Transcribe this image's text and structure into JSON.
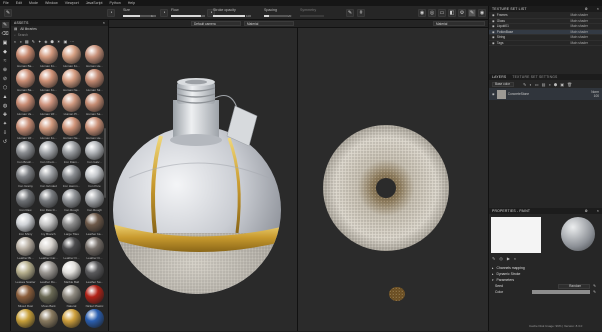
{
  "menu": [
    "File",
    "Edit",
    "Mode",
    "Window",
    "Viewport",
    "JavaScript",
    "Python",
    "Help"
  ],
  "toolbar": {
    "size_label": "Size",
    "size_value": "100",
    "size_pct": 0.55,
    "flow_label": "Flow",
    "flow_value": "100",
    "flow_pct": 1.0,
    "stroke_label": "Stroke opacity",
    "stroke_value": "100",
    "stroke_pct": 1.0,
    "spacing_label": "Spacing",
    "spacing_value": "20",
    "spacing_pct": 0.2,
    "symmetry_label": "Symmetry"
  },
  "assets": {
    "title": "ASSETS",
    "all_label": "All libraries",
    "search_placeholder": "Search",
    "items": [
      {
        "label": "Human Ba...",
        "color": "#c98a70"
      },
      {
        "label": "Human Fo...",
        "color": "#d49a7f"
      },
      {
        "label": "Human Fo...",
        "color": "#d6a083"
      },
      {
        "label": "Human He...",
        "color": "#c8917a"
      },
      {
        "label": "Human Ba...",
        "color": "#cd9077"
      },
      {
        "label": "Human Fo...",
        "color": "#d09378"
      },
      {
        "label": "Human Ne...",
        "color": "#d59c80"
      },
      {
        "label": "Human Sk...",
        "color": "#c48a72"
      },
      {
        "label": "Human Va...",
        "color": "#c98c74"
      },
      {
        "label": "Human Wr...",
        "color": "#d19680"
      },
      {
        "label": "Human Pl...",
        "color": "#cf987f"
      },
      {
        "label": "Human Sa...",
        "color": "#c58c73"
      },
      {
        "label": "Human Wr...",
        "color": "#c98e76"
      },
      {
        "label": "Human Fo...",
        "color": "#d29a7e"
      },
      {
        "label": "Human Ne...",
        "color": "#d09479"
      },
      {
        "label": "Human He...",
        "color": "#cb9178"
      },
      {
        "label": "Iron Brush...",
        "color": "#8c8f93"
      },
      {
        "label": "Iron Chem...",
        "color": "#a6a9ad"
      },
      {
        "label": "Iron Diam...",
        "color": "#9a9da1"
      },
      {
        "label": "Iron Galv...",
        "color": "#b3b6ba"
      },
      {
        "label": "Iron Grainy",
        "color": "#7e8185"
      },
      {
        "label": "Iron Grinded",
        "color": "#9fa2a6"
      },
      {
        "label": "Iron Hamm...",
        "color": "#8a8d91"
      },
      {
        "label": "Iron Pure",
        "color": "#c4c7cb"
      },
      {
        "label": "Iron Raw",
        "color": "#6f7276"
      },
      {
        "label": "Iron Raw D...",
        "color": "#7a7d81"
      },
      {
        "label": "Iron Rough",
        "color": "#909397"
      },
      {
        "label": "Iron Rough",
        "color": "#a3a6aa"
      },
      {
        "label": "Iron Shiny",
        "color": "#d0d3d7"
      },
      {
        "label": "Ivy Branch",
        "color": "#c7c7c7"
      },
      {
        "label": "Large Tiles",
        "color": "#8d8d8d"
      },
      {
        "label": "Leather ba...",
        "color": "#6e5a4a"
      },
      {
        "label": "Leather Bi...",
        "color": "#b9b0a4"
      },
      {
        "label": "Leather Car...",
        "color": "#d8d4cf"
      },
      {
        "label": "Leather Fi...",
        "color": "#4b4b4d"
      },
      {
        "label": "Leather Fi...",
        "color": "#77706a"
      },
      {
        "label": "Leaves Scatter",
        "color": "#b7b08e"
      },
      {
        "label": "Leather Ro...",
        "color": "#9d9994"
      },
      {
        "label": "Marble Ball",
        "color": "#e2e0dc"
      },
      {
        "label": "Leather Sa...",
        "color": "#5a5a5c"
      },
      {
        "label": "Mixed Rust",
        "color": "#8c5f3c"
      },
      {
        "label": "Moss Bark",
        "color": "#6b6a55"
      },
      {
        "label": "Natural",
        "color": "#8f8a80"
      },
      {
        "label": "Nickel Plastic",
        "color": "#b32318"
      },
      {
        "label": "",
        "color": "#c9a13a"
      },
      {
        "label": "",
        "color": "#8a7b60"
      },
      {
        "label": "",
        "color": "#cfa03c"
      },
      {
        "label": "",
        "color": "#2b5fb0"
      }
    ]
  },
  "viewport": {
    "camera_left": "Default camera",
    "channel_left": "Material",
    "channel_right": "Material"
  },
  "texture_set_list": {
    "title": "TEXTURE SET LIST",
    "rows": [
      {
        "name": "Frames",
        "shader": "Main shader"
      },
      {
        "name": "Glass",
        "shader": "Main shader"
      },
      {
        "name": "Liquid01",
        "shader": "Main shader"
      },
      {
        "name": "PotionBase",
        "shader": "Main shader"
      },
      {
        "name": "String",
        "shader": "Main shader"
      },
      {
        "name": "Tags",
        "shader": "Main shader"
      }
    ]
  },
  "layers": {
    "tab1": "LAYERS",
    "tab2": "TEXTURE SET SETTINGS",
    "channel": "Base color",
    "layer_name": "ConcreteStone",
    "blend": "Norm",
    "opacity": "100"
  },
  "properties": {
    "title": "PROPERTIES - PAINT",
    "sections": [
      "Channels mapping",
      "Dynamic Stroke",
      "Parameters"
    ],
    "seed_label": "Seed",
    "seed_value": "Random",
    "color_label": "Color"
  },
  "status": "Cache Disk Usage: 99% | Version: 8.3.0"
}
